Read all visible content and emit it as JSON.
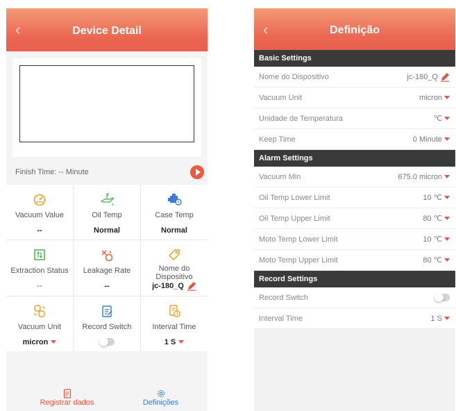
{
  "left": {
    "title": "Device Detail",
    "back_icon": "chevron-left-icon",
    "finish_time": "Finish Time: -- Minute",
    "cells": [
      {
        "label": "Vacuum Value",
        "value": "--",
        "icon": "gauge-icon"
      },
      {
        "label": "Oil Temp",
        "value": "Normal",
        "icon": "oil-can-icon"
      },
      {
        "label": "Case Temp",
        "value": "Normal",
        "icon": "engine-icon"
      },
      {
        "label": "Extraction Status",
        "value": "--",
        "icon": "extraction-icon"
      },
      {
        "label": "Leakage Rate",
        "value": "--",
        "icon": "leakage-icon"
      },
      {
        "label": "Nome do Dispositivo",
        "value": "jc-180_Q",
        "icon": "tag-icon"
      },
      {
        "label": "Vacuum Unit",
        "value": "micron",
        "icon": "unit-icon"
      },
      {
        "label": "Record Switch",
        "value": "",
        "icon": "record-icon"
      },
      {
        "label": "Interval Time",
        "value": "1 S",
        "icon": "interval-icon"
      }
    ],
    "nav": {
      "records": "Registrar dados",
      "settings": "Definições"
    },
    "colors": {
      "accent": "#e9604d",
      "orange_icon": "#e8a020",
      "blue_icon": "#3a7bd5"
    }
  },
  "right": {
    "title": "Definição",
    "back_icon": "chevron-left-icon",
    "sections": [
      {
        "title": "Basic Settings",
        "rows": [
          {
            "key": "Nome do Dispositivo",
            "value": "jc-180_Q",
            "kind": "edit"
          },
          {
            "key": "Vacuum Unit",
            "value": "micron",
            "kind": "dropdown"
          },
          {
            "key": "Unidade de Temperatura",
            "value": "℃",
            "kind": "dropdown"
          },
          {
            "key": "Keep Time",
            "value": "0 Minute",
            "kind": "dropdown"
          }
        ]
      },
      {
        "title": "Alarm Settings",
        "rows": [
          {
            "key": "Vacuum Min",
            "value": "675.0 micron",
            "kind": "dropdown"
          },
          {
            "key": "Oil Temp Lower Limit",
            "value": "10 ℃",
            "kind": "dropdown"
          },
          {
            "key": "Oil Temp Upper Limit",
            "value": "80 ℃",
            "kind": "dropdown"
          },
          {
            "key": "Moto Temp Lower Limit",
            "value": "10 ℃",
            "kind": "dropdown"
          },
          {
            "key": "Moto Temp Upper Limit",
            "value": "80 ℃",
            "kind": "dropdown"
          }
        ]
      },
      {
        "title": "Record Settings",
        "rows": [
          {
            "key": "Record Switch",
            "value": "",
            "kind": "toggle"
          },
          {
            "key": "Interval Time",
            "value": "1 S",
            "kind": "dropdown"
          }
        ]
      }
    ]
  }
}
